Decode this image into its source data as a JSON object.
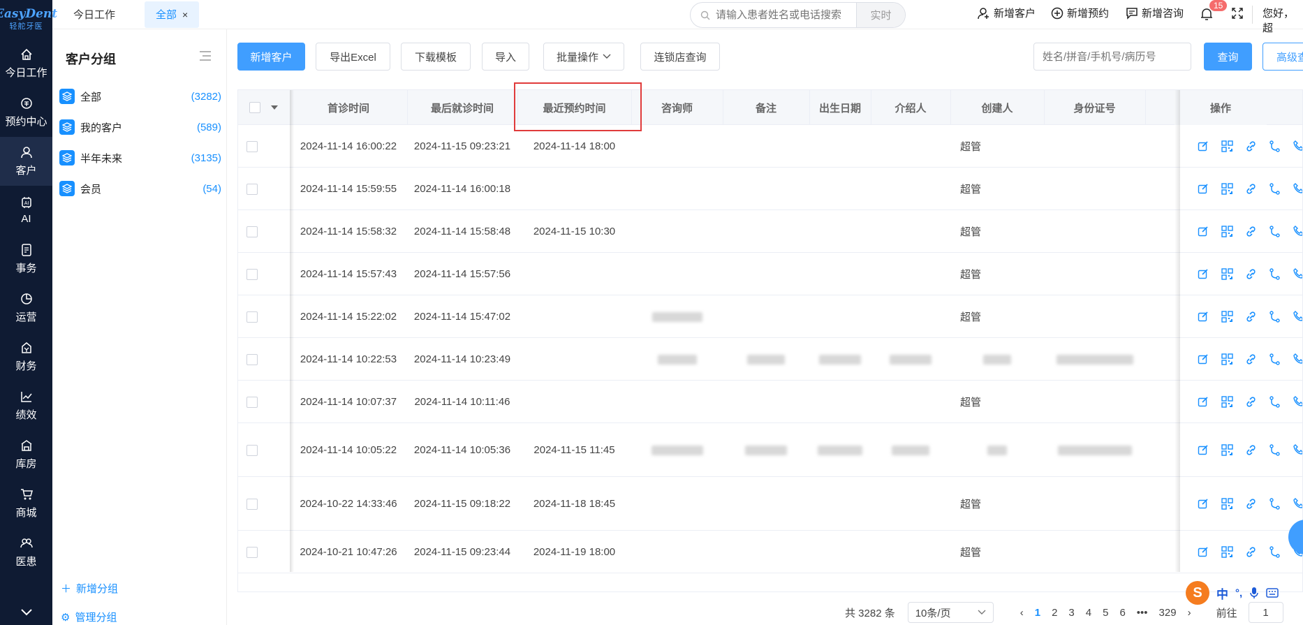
{
  "brand": {
    "line1": "EasyDent",
    "line2": "轻舵牙医"
  },
  "nav": [
    {
      "label": "今日工作",
      "icon": "home-icon"
    },
    {
      "label": "预约中心",
      "icon": "appointment-icon"
    },
    {
      "label": "客户",
      "icon": "user-icon"
    },
    {
      "label": "AI",
      "icon": "ai-chip-icon"
    },
    {
      "label": "事务",
      "icon": "task-icon"
    },
    {
      "label": "运营",
      "icon": "pie-chart-icon"
    },
    {
      "label": "财务",
      "icon": "finance-icon"
    },
    {
      "label": "绩效",
      "icon": "line-chart-icon"
    },
    {
      "label": "库房",
      "icon": "warehouse-icon"
    },
    {
      "label": "商城",
      "icon": "cart-icon"
    },
    {
      "label": "医患",
      "icon": "doctor-patient-icon"
    }
  ],
  "tabs": [
    {
      "label": "今日工作"
    },
    {
      "label": "全部",
      "close": "×"
    }
  ],
  "search": {
    "placeholder": "请输入患者姓名或电话搜索",
    "mode": "实时"
  },
  "top_actions": {
    "new_customer": "新增客户",
    "new_appointment": "新增预约",
    "new_consult": "新增咨询",
    "notifications": "15",
    "greeting": "您好，超"
  },
  "groups": {
    "title": "客户分组",
    "items": [
      {
        "label": "全部",
        "count": "(3282)"
      },
      {
        "label": "我的客户",
        "count": "(589)"
      },
      {
        "label": "半年未来",
        "count": "(3135)"
      },
      {
        "label": "会员",
        "count": "(54)"
      }
    ],
    "add": "新增分组",
    "manage": "管理分组"
  },
  "toolbar": {
    "new_customer": "新增客户",
    "export": "导出Excel",
    "download_template": "下载模板",
    "import": "导入",
    "batch": "批量操作",
    "chain": "连锁店查询",
    "query_placeholder": "姓名/拼音/手机号/病历号",
    "query": "查询",
    "advanced": "高级查"
  },
  "table": {
    "headers": [
      "首诊时间",
      "最后就诊时间",
      "最近预约时间",
      "咨询师",
      "备注",
      "出生日期",
      "介绍人",
      "创建人",
      "身份证号",
      "操作"
    ],
    "rows": [
      {
        "first": "2024-11-14 16:00:22",
        "last": "2024-11-15 09:23:21",
        "appt": "2024-11-14 18:00",
        "creator": "超管"
      },
      {
        "first": "2024-11-14 15:59:55",
        "last": "2024-11-14 16:00:18",
        "appt": "",
        "creator": "超管"
      },
      {
        "first": "2024-11-14 15:58:32",
        "last": "2024-11-14 15:58:48",
        "appt": "2024-11-15 10:30",
        "creator": "超管"
      },
      {
        "first": "2024-11-14 15:57:43",
        "last": "2024-11-14 15:57:56",
        "appt": "",
        "creator": "超管"
      },
      {
        "first": "2024-11-14 15:22:02",
        "last": "2024-11-14 15:47:02",
        "appt": "",
        "creator": "超管"
      },
      {
        "first": "2024-11-14 10:22:53",
        "last": "2024-11-14 10:23:49",
        "appt": "",
        "creator": ""
      },
      {
        "first": "2024-11-14 10:07:37",
        "last": "2024-11-14 10:11:46",
        "appt": "",
        "creator": "超管"
      },
      {
        "first": "2024-11-14 10:05:22",
        "last": "2024-11-14 10:05:36",
        "appt": "2024-11-15 11:45",
        "creator": ""
      },
      {
        "first": "2024-10-22 14:33:46",
        "last": "2024-11-15 09:18:22",
        "appt": "2024-11-18 18:45",
        "creator": "超管"
      },
      {
        "first": "2024-10-21 10:47:26",
        "last": "2024-11-15 09:23:44",
        "appt": "2024-11-19 18:00",
        "creator": "超管"
      }
    ]
  },
  "pager": {
    "total": "共 3282 条",
    "page_size": "10条/页",
    "pages": [
      "1",
      "2",
      "3",
      "4",
      "5",
      "6"
    ],
    "more": "•••",
    "last": "329",
    "goto": "前往",
    "goto_value": "1"
  },
  "ime": {
    "lang": "中",
    "punct": "°,"
  },
  "colors": {
    "primary": "#409eff",
    "nav_bg": "#0f1b33",
    "highlight": "#e03b3b"
  }
}
